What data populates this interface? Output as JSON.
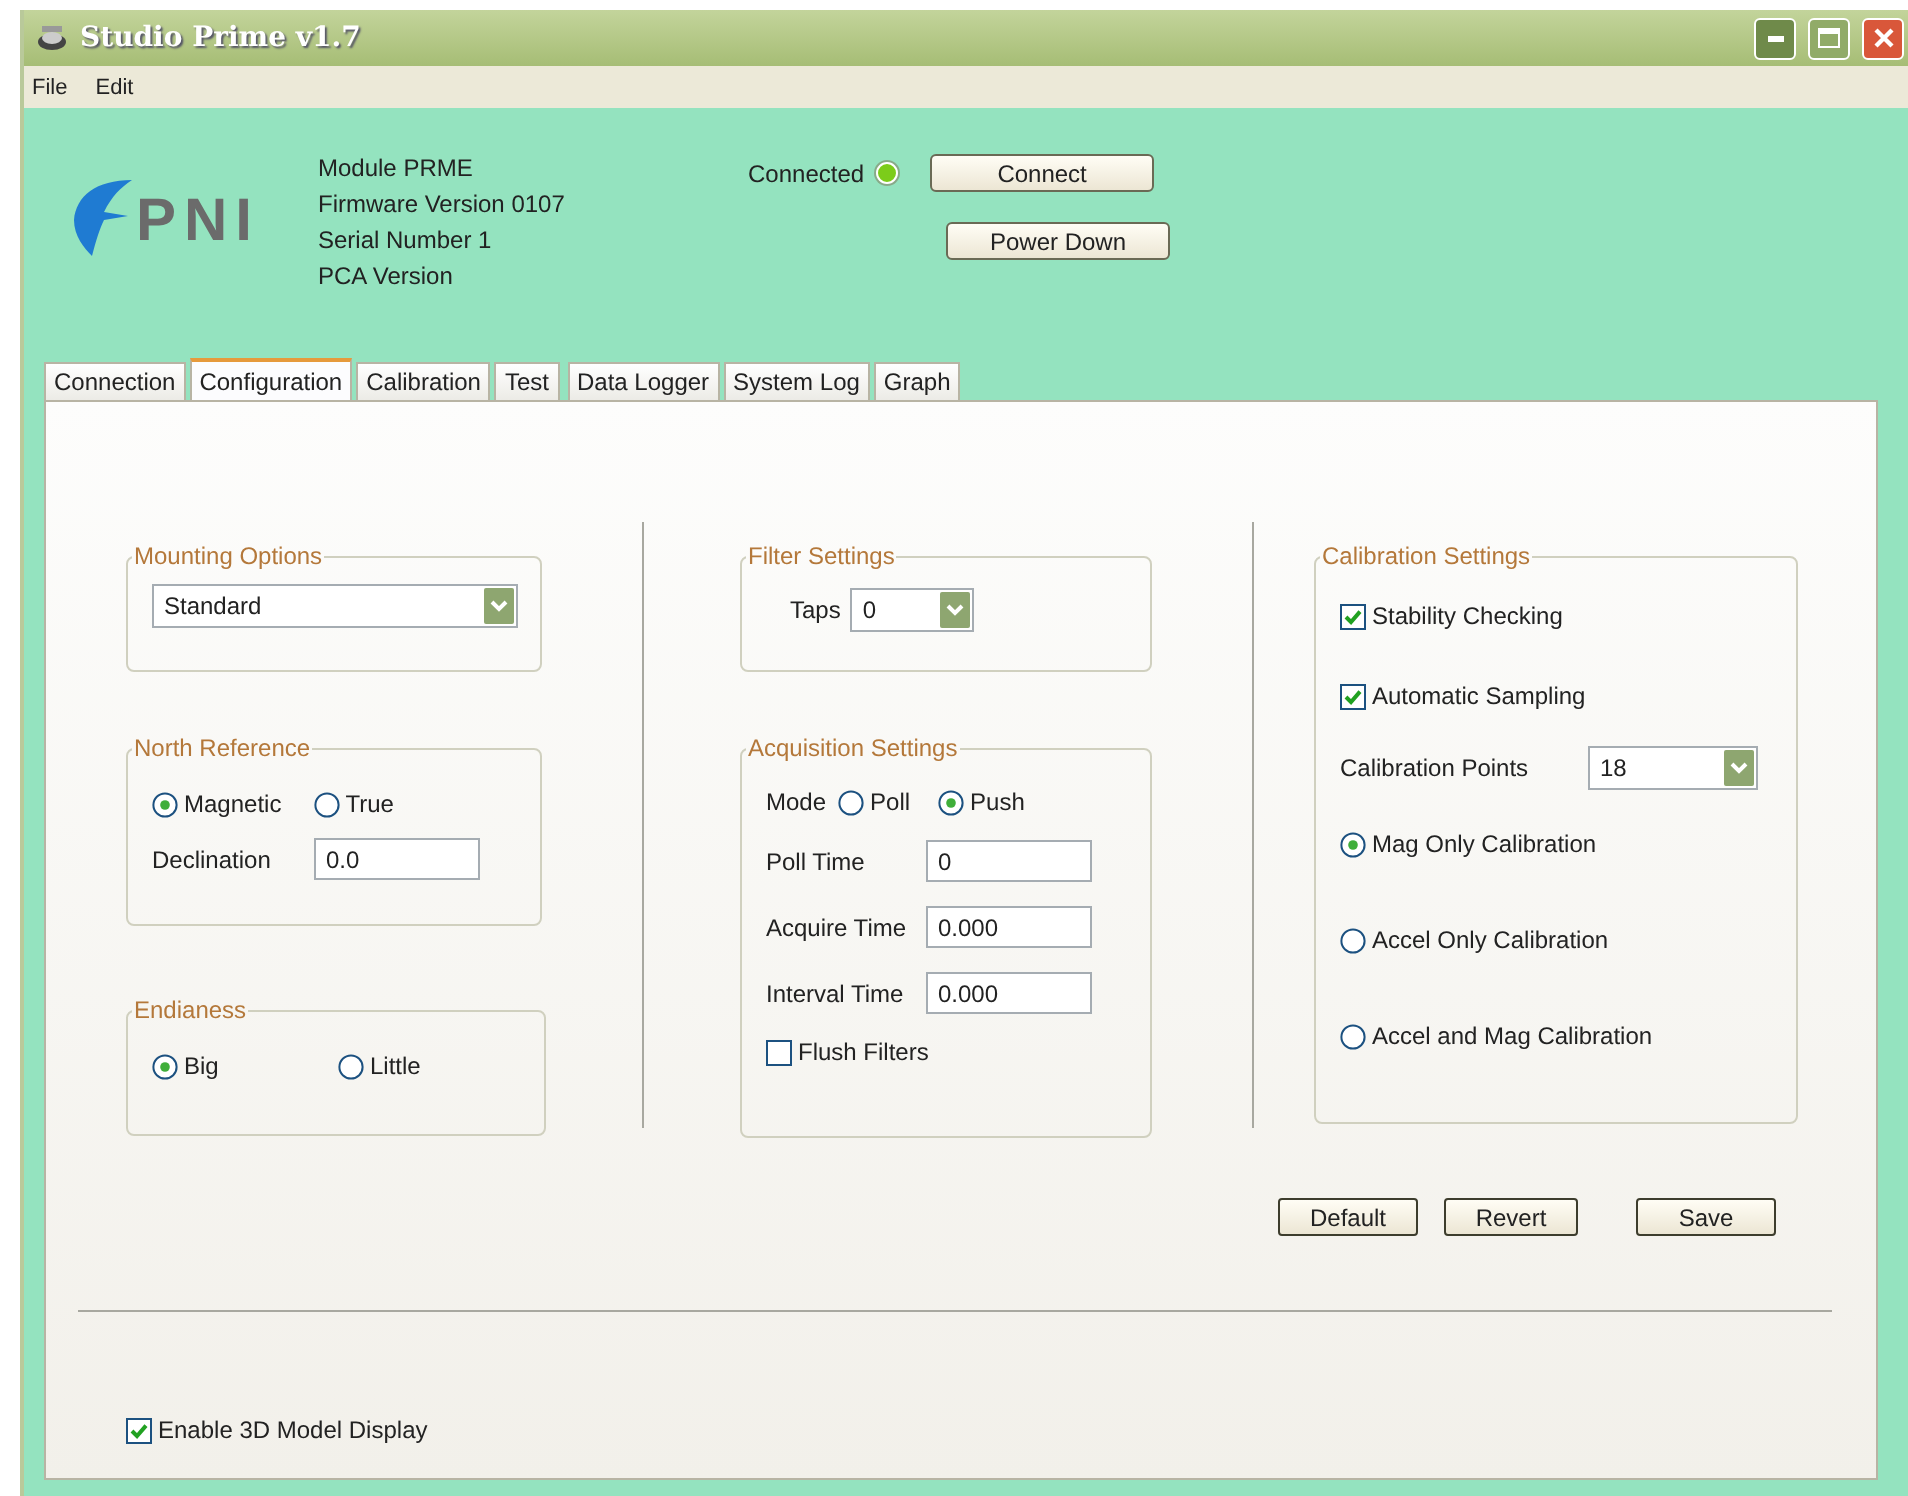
{
  "window": {
    "title": "Studio Prime v1.7"
  },
  "menu": [
    {
      "label": "File"
    },
    {
      "label": "Edit"
    }
  ],
  "logo": {
    "text": "PNI"
  },
  "module_info": [
    "Module PRME",
    "Firmware Version 0107",
    "Serial Number 1",
    "PCA Version"
  ],
  "connection": {
    "label": "Connected",
    "on": true,
    "buttons": [
      "Connect",
      "Power Down"
    ]
  },
  "tabs": [
    {
      "label": "Connection",
      "selected": false
    },
    {
      "label": "Configuration",
      "selected": true
    },
    {
      "label": "Calibration",
      "selected": false
    },
    {
      "label": "Test",
      "selected": false
    },
    {
      "label": "Data Logger",
      "selected": false
    },
    {
      "label": "System Log",
      "selected": false
    },
    {
      "label": "Graph",
      "selected": false
    }
  ],
  "mounting_options": {
    "title": "Mounting Options",
    "value": "Standard"
  },
  "north_reference": {
    "title": "North Reference",
    "options": [
      {
        "label": "Magnetic",
        "selected": true
      },
      {
        "label": "True",
        "selected": false
      }
    ],
    "declination_label": "Declination",
    "declination_value": "0.0"
  },
  "endianess": {
    "title": "Endianess",
    "options": [
      {
        "label": "Big",
        "selected": true
      },
      {
        "label": "Little",
        "selected": false
      }
    ]
  },
  "filter_settings": {
    "title": "Filter Settings",
    "taps_label": "Taps",
    "taps_value": "0"
  },
  "acquisition_settings": {
    "title": "Acquisition Settings",
    "mode_label": "Mode",
    "modes": [
      {
        "label": "Poll",
        "selected": false
      },
      {
        "label": "Push",
        "selected": true
      }
    ],
    "fields": [
      {
        "label": "Poll Time",
        "value": "0"
      },
      {
        "label": "Acquire Time",
        "value": "0.000"
      },
      {
        "label": "Interval Time",
        "value": "0.000"
      }
    ],
    "flush_filters": {
      "label": "Flush Filters",
      "checked": false
    }
  },
  "calibration_settings": {
    "title": "Calibration Settings",
    "checks": [
      {
        "label": "Stability Checking",
        "checked": true
      },
      {
        "label": "Automatic Sampling",
        "checked": true
      }
    ],
    "points_label": "Calibration Points",
    "points_value": "18",
    "modes": [
      {
        "label": "Mag Only Calibration",
        "selected": true
      },
      {
        "label": "Accel Only Calibration",
        "selected": false
      },
      {
        "label": "Accel and Mag Calibration",
        "selected": false
      }
    ]
  },
  "buttons": [
    "Default",
    "Revert",
    "Save"
  ],
  "enable_3d": {
    "label": "Enable 3D Model Display",
    "checked": true
  }
}
